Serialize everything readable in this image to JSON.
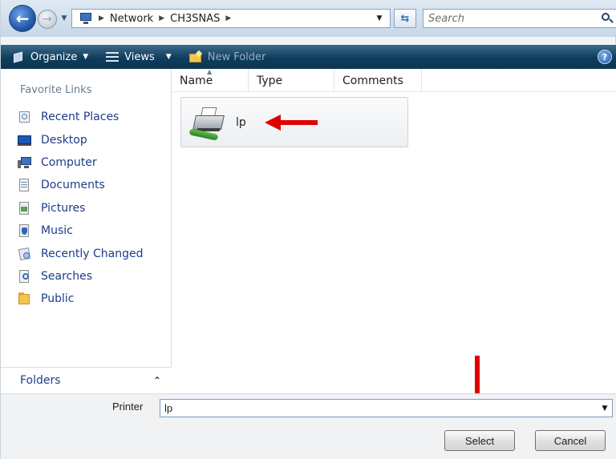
{
  "address_bar": {
    "crumbs": [
      "Network",
      "CH3SNAS"
    ],
    "search_placeholder": "Search"
  },
  "toolbar": {
    "organize_label": "Organize",
    "views_label": "Views",
    "new_folder_label": "New Folder"
  },
  "nav_pane": {
    "heading": "Favorite Links",
    "items": [
      {
        "label": "Recent Places",
        "icon": "recent-places-icon"
      },
      {
        "label": "Desktop",
        "icon": "desktop-icon"
      },
      {
        "label": "Computer",
        "icon": "computer-icon"
      },
      {
        "label": "Documents",
        "icon": "documents-icon"
      },
      {
        "label": "Pictures",
        "icon": "pictures-icon"
      },
      {
        "label": "Music",
        "icon": "music-icon"
      },
      {
        "label": "Recently Changed",
        "icon": "recently-changed-icon"
      },
      {
        "label": "Searches",
        "icon": "searches-icon"
      },
      {
        "label": "Public",
        "icon": "public-folder-icon"
      }
    ],
    "folders_label": "Folders"
  },
  "file_list": {
    "columns": [
      "Name",
      "Type",
      "Comments"
    ],
    "items": [
      {
        "name": "lp",
        "icon": "printer-icon"
      }
    ]
  },
  "bottom_panel": {
    "printer_label": "Printer",
    "printer_value": "lp",
    "select_label": "Select",
    "cancel_label": "Cancel"
  },
  "colors": {
    "toolbar": "#0f3d5c",
    "link": "#1e3c8a",
    "annotation_arrow": "#e00000"
  }
}
